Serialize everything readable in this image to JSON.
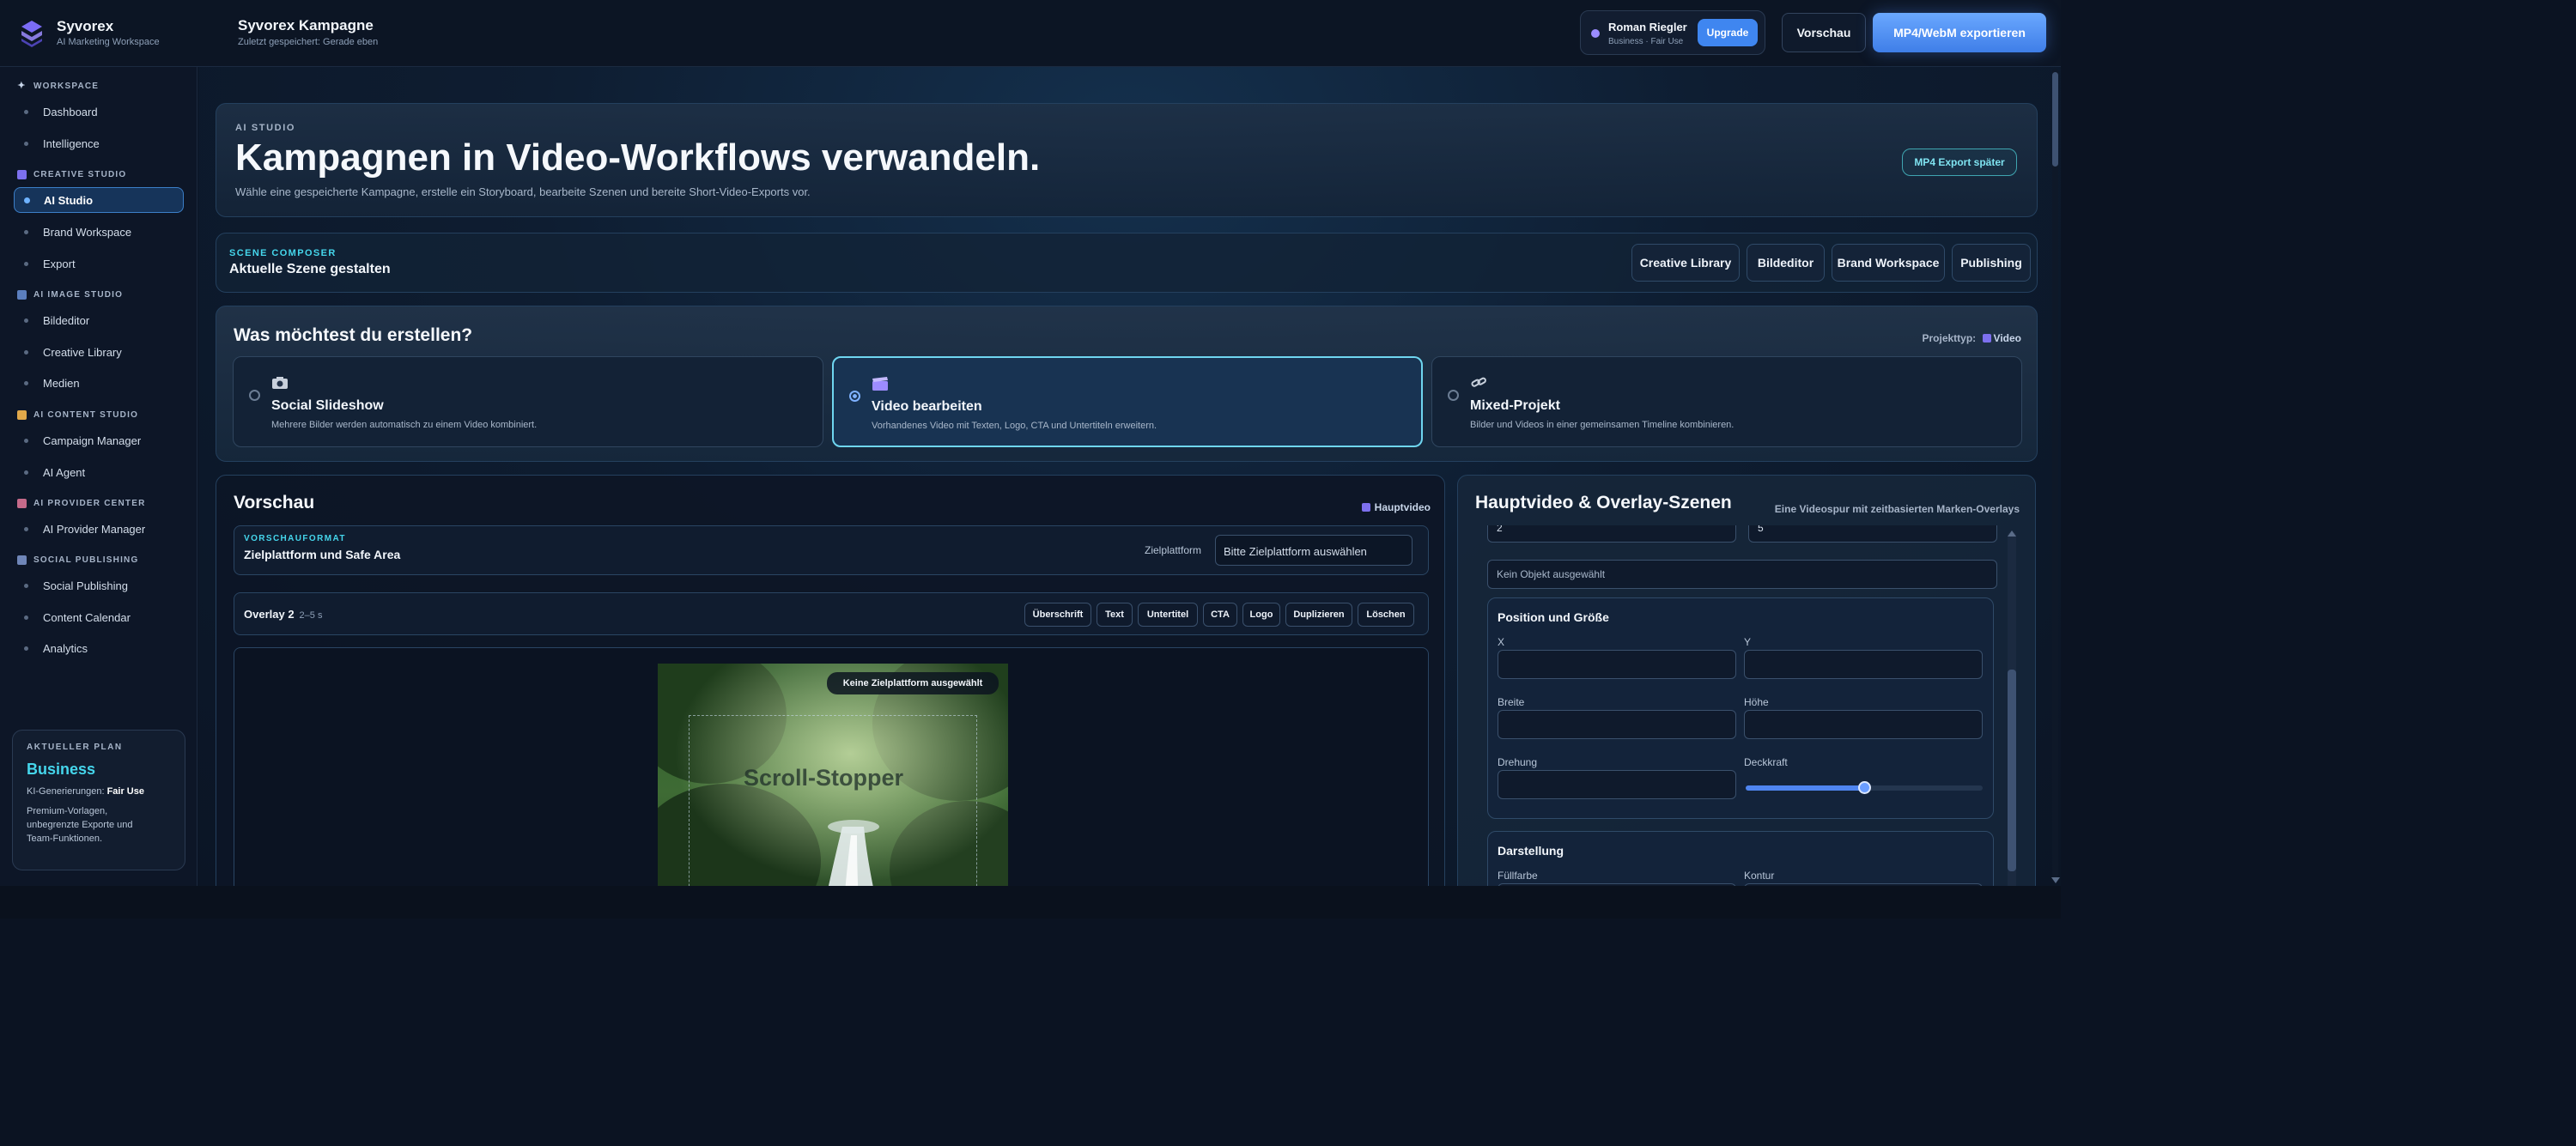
{
  "topbar": {
    "brand_name": "Syvorex",
    "brand_sub": "AI Marketing Workspace",
    "project_title": "Syvorex Kampagne",
    "project_saved": "Zuletzt gespeichert: Gerade eben",
    "user_name": "Roman Riegler",
    "user_plan": "Business · Fair Use",
    "upgrade_label": "Upgrade",
    "preview_label": "Vorschau",
    "export_label": "MP4/WebM exportieren"
  },
  "sidebar": {
    "sections": [
      {
        "label": "WORKSPACE",
        "icon": "sparkle-icon",
        "items": [
          "Dashboard",
          "Intelligence"
        ]
      },
      {
        "label": "CREATIVE STUDIO",
        "icon": "film-icon",
        "items": [
          "AI Studio",
          "Brand Workspace",
          "Export"
        ]
      },
      {
        "label": "AI IMAGE STUDIO",
        "icon": "image-icon",
        "items": [
          "Bildeditor",
          "Creative Library",
          "Medien"
        ]
      },
      {
        "label": "AI CONTENT STUDIO",
        "icon": "pen-icon",
        "items": [
          "Campaign Manager",
          "AI Agent"
        ]
      },
      {
        "label": "AI PROVIDER CENTER",
        "icon": "robot-icon",
        "items": [
          "AI Provider Manager"
        ]
      },
      {
        "label": "SOCIAL PUBLISHING",
        "icon": "calendar-icon",
        "items": [
          "Social Publishing",
          "Content Calendar",
          "Analytics"
        ]
      }
    ],
    "active_item": "AI Studio",
    "plan": {
      "label": "AKTUELLER PLAN",
      "name": "Business",
      "gen_label": "KI-Generierungen:",
      "gen_value": "Fair Use",
      "desc": "Premium-Vorlagen, unbegrenzte Exporte und Team-Funktionen."
    }
  },
  "hero": {
    "kicker": "AI STUDIO",
    "title": "Kampagnen in Video-Workflows verwandeln.",
    "subtitle": "Wähle eine gespeicherte Kampagne, erstelle ein Storyboard, bearbeite Szenen und bereite Short-Video-Exports vor.",
    "badge": "MP4 Export später"
  },
  "composer": {
    "kicker": "SCENE COMPOSER",
    "title": "Aktuelle Szene gestalten",
    "chips": [
      "Creative Library",
      "Bildeditor",
      "Brand Workspace",
      "Publishing"
    ]
  },
  "create": {
    "title": "Was möchtest du erstellen?",
    "projtype_label": "Projekttyp:",
    "projtype_value": "Video",
    "options": [
      {
        "title": "Social Slideshow",
        "desc": "Mehrere Bilder werden automatisch zu einem Video kombiniert.",
        "icon": "camera-icon",
        "selected": false
      },
      {
        "title": "Video bearbeiten",
        "desc": "Vorhandenes Video mit Texten, Logo, CTA und Untertiteln erweitern.",
        "icon": "clapper-icon",
        "selected": true
      },
      {
        "title": "Mixed-Projekt",
        "desc": "Bilder und Videos in einer gemeinsamen Timeline kombinieren.",
        "icon": "link-icon",
        "selected": false
      }
    ]
  },
  "preview": {
    "title": "Vorschau",
    "tag": "Hauptvideo",
    "format_kicker": "VORSCHAUFORMAT",
    "format_title": "Zielplattform und Safe Area",
    "platform_label": "Zielplattform",
    "platform_value": "Bitte Zielplattform auswählen",
    "overlay_title": "Overlay 2",
    "overlay_range": "2–5 s",
    "tools": [
      "Überschrift",
      "Text",
      "Untertitel",
      "CTA",
      "Logo",
      "Duplizieren",
      "Löschen"
    ],
    "canvas_badge": "Keine Zielplattform ausgewählt",
    "canvas_text": "Scroll-Stopper"
  },
  "scene": {
    "title": "Hauptvideo & Overlay-Szenen",
    "subtitle": "Eine Videospur mit zeitbasierten Marken-Overlays",
    "top_field_1": "2",
    "top_field_2": "5",
    "no_object": "Kein Objekt ausgewählt",
    "position_title": "Position und Größe",
    "x_label": "X",
    "y_label": "Y",
    "width_label": "Breite",
    "height_label": "Höhe",
    "rotation_label": "Drehung",
    "opacity_label": "Deckkraft",
    "opacity_value": 0.5,
    "display_title": "Darstellung",
    "fill_label": "Füllfarbe",
    "stroke_label": "Kontur"
  }
}
